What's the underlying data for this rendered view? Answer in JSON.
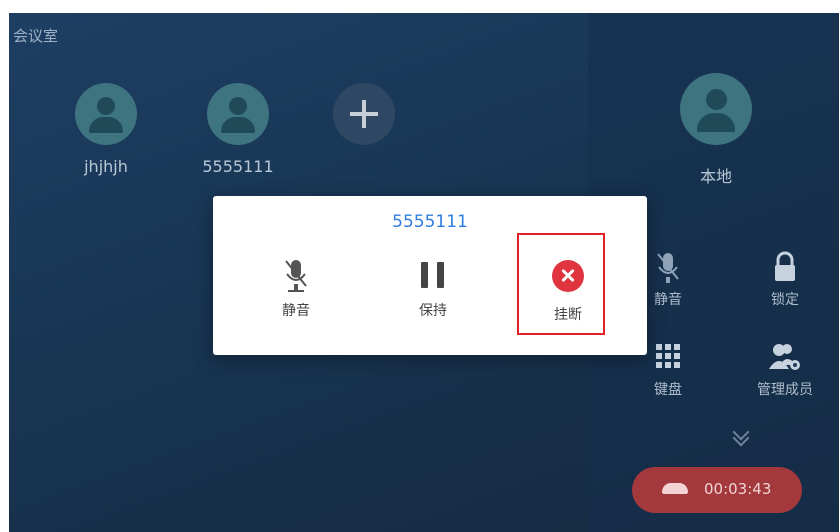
{
  "screen": {
    "title": "会议室"
  },
  "participants": [
    {
      "name": "jhjhjh"
    },
    {
      "name": "5555111"
    }
  ],
  "add_participant": {
    "icon": "plus-icon"
  },
  "local": {
    "label": "本地"
  },
  "right_controls": {
    "mute": "静音",
    "lock": "锁定",
    "keypad": "键盘",
    "manage_members": "管理成员"
  },
  "call_timer": "00:03:43",
  "modal": {
    "title": "5555111",
    "mute_label": "静音",
    "hold_label": "保持",
    "end_label": "挂断"
  },
  "colors": {
    "accent_blue": "#2f7de0",
    "end_red": "#e0343f",
    "highlight_red": "#e52125",
    "hangup_pill": "#a3383d"
  }
}
